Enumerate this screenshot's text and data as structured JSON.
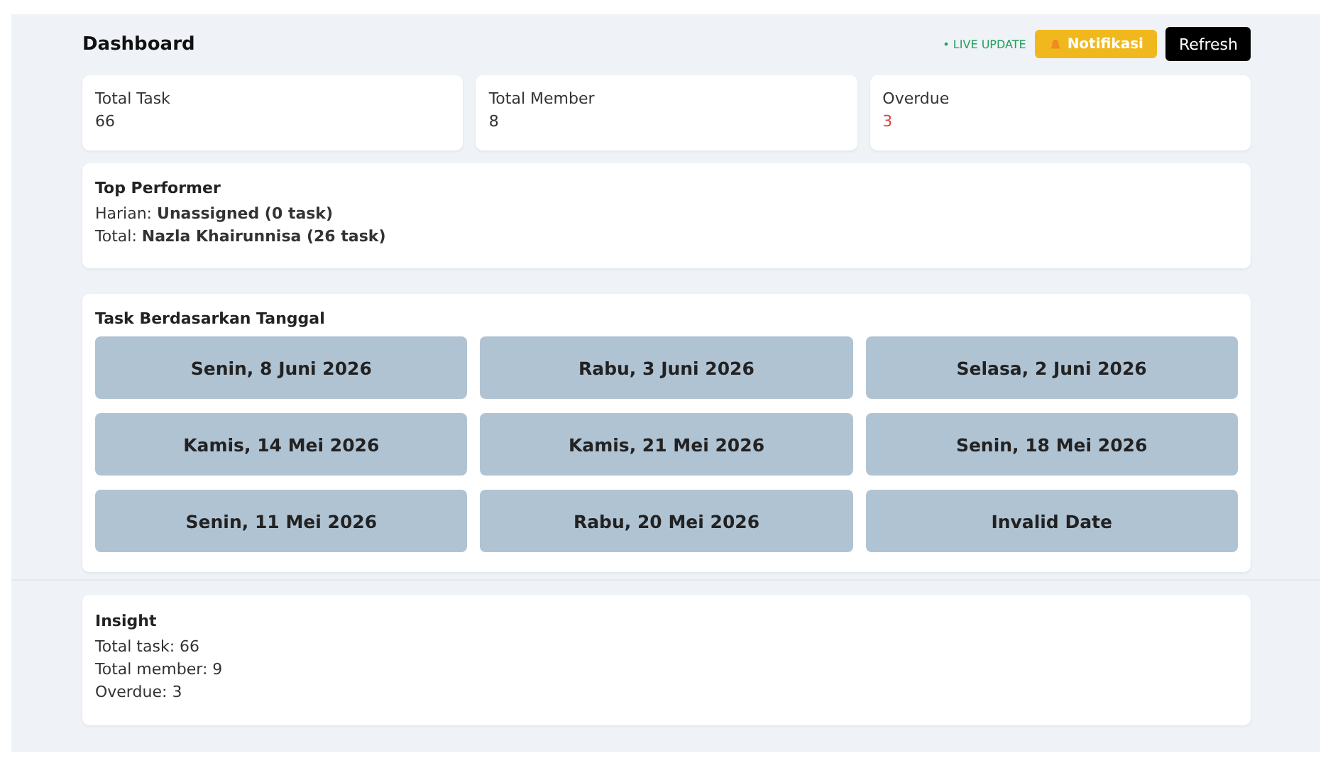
{
  "header": {
    "title": "Dashboard",
    "live_label": "• LIVE UPDATE",
    "notify_button": "Notifikasi",
    "refresh_button": "Refresh"
  },
  "stats": [
    {
      "label": "Total Task",
      "value": "66",
      "alert": false
    },
    {
      "label": "Total Member",
      "value": "8",
      "alert": false
    },
    {
      "label": "Overdue",
      "value": "3",
      "alert": true
    }
  ],
  "top_performer": {
    "title": "Top Performer",
    "lines": [
      "Harian: **Unassigned (0 task)**",
      "Total: **Nazla Khairunnisa (26 task)**"
    ]
  },
  "dates": {
    "title": "Task Berdasarkan Tanggal",
    "items": [
      "Senin, 8 Juni 2026",
      "Rabu, 3 Juni 2026",
      "Selasa, 2 Juni 2026",
      "Kamis, 14 Mei 2026",
      "Kamis, 21 Mei 2026",
      "Senin, 18 Mei 2026",
      "Senin, 11 Mei 2026",
      "Rabu, 20 Mei 2026",
      "Invalid Date"
    ]
  },
  "insight": {
    "title": "Insight",
    "lines": [
      "Total task: 66",
      "Total member: 9",
      "Overdue: 3"
    ]
  }
}
